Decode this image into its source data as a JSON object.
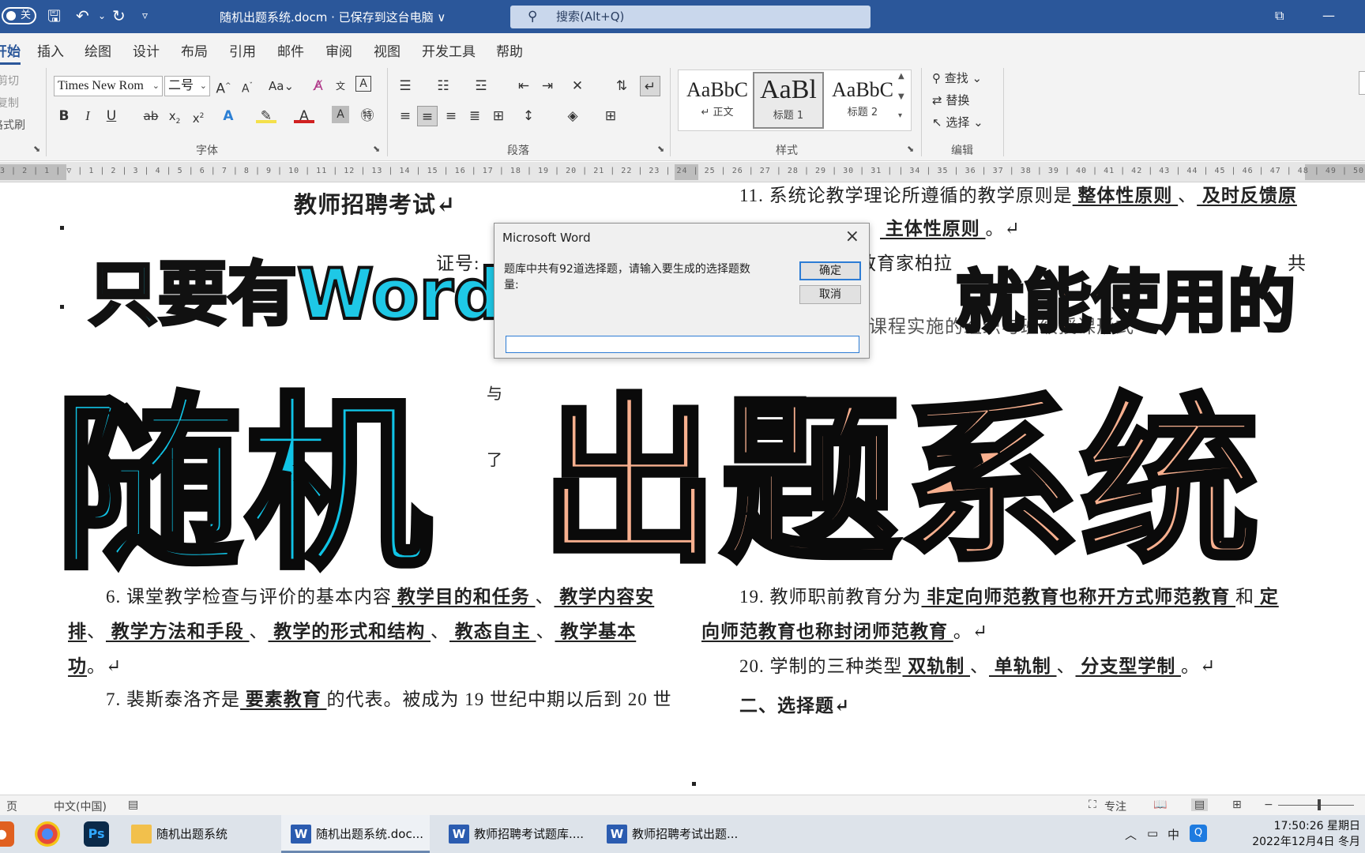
{
  "titlebar": {
    "autosave": "关",
    "document_title": "随机出题系统.docm · 已保存到这台电脑 ∨",
    "search_placeholder": "搜索(Alt+Q)"
  },
  "tabs": [
    {
      "label": "开始",
      "active": true
    },
    {
      "label": "插入"
    },
    {
      "label": "绘图"
    },
    {
      "label": "设计"
    },
    {
      "label": "布局"
    },
    {
      "label": "引用"
    },
    {
      "label": "邮件"
    },
    {
      "label": "审阅"
    },
    {
      "label": "视图"
    },
    {
      "label": "开发工具"
    },
    {
      "label": "帮助"
    }
  ],
  "ribbon": {
    "clipboard": {
      "cut": "剪切",
      "copy": "复制",
      "format_painter": "格式刷"
    },
    "font": {
      "font_name": "Times New Rom",
      "font_size": "二号",
      "group_label": "字体"
    },
    "paragraph": {
      "group_label": "段落"
    },
    "styles": {
      "items": [
        {
          "sample": "AaBbC",
          "name": "↵ 正文"
        },
        {
          "sample": "AaBl",
          "name": "标题 1"
        },
        {
          "sample": "AaBbC",
          "name": "标题 2"
        }
      ],
      "group_label": "样式"
    },
    "editing": {
      "find": "查找",
      "replace": "替换",
      "select": "选择",
      "group_label": "编辑"
    }
  },
  "ruler": {
    "marks": "3 | 2 | 1 | ▽ | 1 | 2 | 3 | 4 | 5 | 6 | 7 | 8 | 9 | 10 | 11 | 12 | 13 | 14 | 15 | 16 | 17 | 18 | 19 | 20 | 21 | 22 | 23 | 24 | 25 | 26 | 27 | 28 | 29 | 30 | 31 |   | 34 | 35 | 36 | 37 | 38 | 39 | 40 | 41 | 42 | 43 | 44 | 45 | 46 | 47 | 48 | 49 | 50 | 51 | 52 | 53 | 54 | 55 | 56 | 57 | 58 | 59 | 60 | 61 | 62 | 63 | 64 | 65 | 66 | 67 | 68"
  },
  "document": {
    "heading": "教师招聘考试↵",
    "left_fragments": {
      "zheng_hao": "证号:",
      "yu": "与",
      "le": "了"
    },
    "right_top": {
      "q11_prefix": "11. 系统论教学理论所遵循的教学原则是",
      "q11_a": " 整体性原则 ",
      "q11_sep1": "、",
      "q11_b": " 及时反馈原",
      "q11_cont_sep": "、",
      "q11_c": " 主体性原则 ",
      "q11_end": "。↵",
      "q12_frag": "教育家柏拉",
      "q12_gong": "共",
      "q13_frag": "课程实施的组织与班级授课形式"
    },
    "left_bottom": {
      "q6_prefix": "6. 课堂教学检查与评价的基本内容",
      "q6_a": " 教学目的和任务 ",
      "q6_sep": "、",
      "q6_b": " 教学内容安",
      "q6_b2": "排",
      "q6_c": " 教学方法和手段 ",
      "q6_d": " 教学的形式和结构 ",
      "q6_e": " 教态自主 ",
      "q6_f": " 教学基本",
      "q6_f2": "功",
      "q6_end": "。↵",
      "q7_prefix": "7. 裴斯泰洛齐是",
      "q7_a": " 要素教育 ",
      "q7_suffix": "的代表。被成为 19 世纪中期以后到 20 世"
    },
    "right_bottom": {
      "q19_prefix": "19. 教师职前教育分为",
      "q19_a": " 非定向师范教育也称开方式师范教育 ",
      "q19_and": "和",
      "q19_b": " 定",
      "q19_b2": "向师范教育也称封闭师范教育 ",
      "q19_end": "。↵",
      "q20_prefix": "20. 学制的三种类型",
      "q20_a": " 双轨制 ",
      "q20_sep": "、",
      "q20_b": " 单轨制 ",
      "q20_c": " 分支型学制 ",
      "q20_end": "。↵",
      "section2": "二、选择题↵"
    }
  },
  "overlay": {
    "line1_left": "只要有Word",
    "line1_right": "就能使用的",
    "big_left": "随机",
    "big_right": "出题系统"
  },
  "dialog": {
    "title": "Microsoft Word",
    "message": "题库中共有92道选择题，请输入要生成的选择题数量:",
    "ok_label": "确定",
    "cancel_label": "取消",
    "input_value": ""
  },
  "statusbar": {
    "page": "页",
    "language": "中文(中国)",
    "focus": "专注"
  },
  "taskbar": {
    "apps": [
      {
        "label": "随机出题系统",
        "type": "folder"
      },
      {
        "label": "随机出题系统.doc...",
        "type": "word",
        "active": true
      },
      {
        "label": "教师招聘考试题库....",
        "type": "word"
      },
      {
        "label": "教师招聘考试出题...",
        "type": "word"
      }
    ],
    "ps_label": "Ps",
    "ime": "中",
    "time": "17:50:26 星期日",
    "date": "2022年12月4日 冬月"
  }
}
